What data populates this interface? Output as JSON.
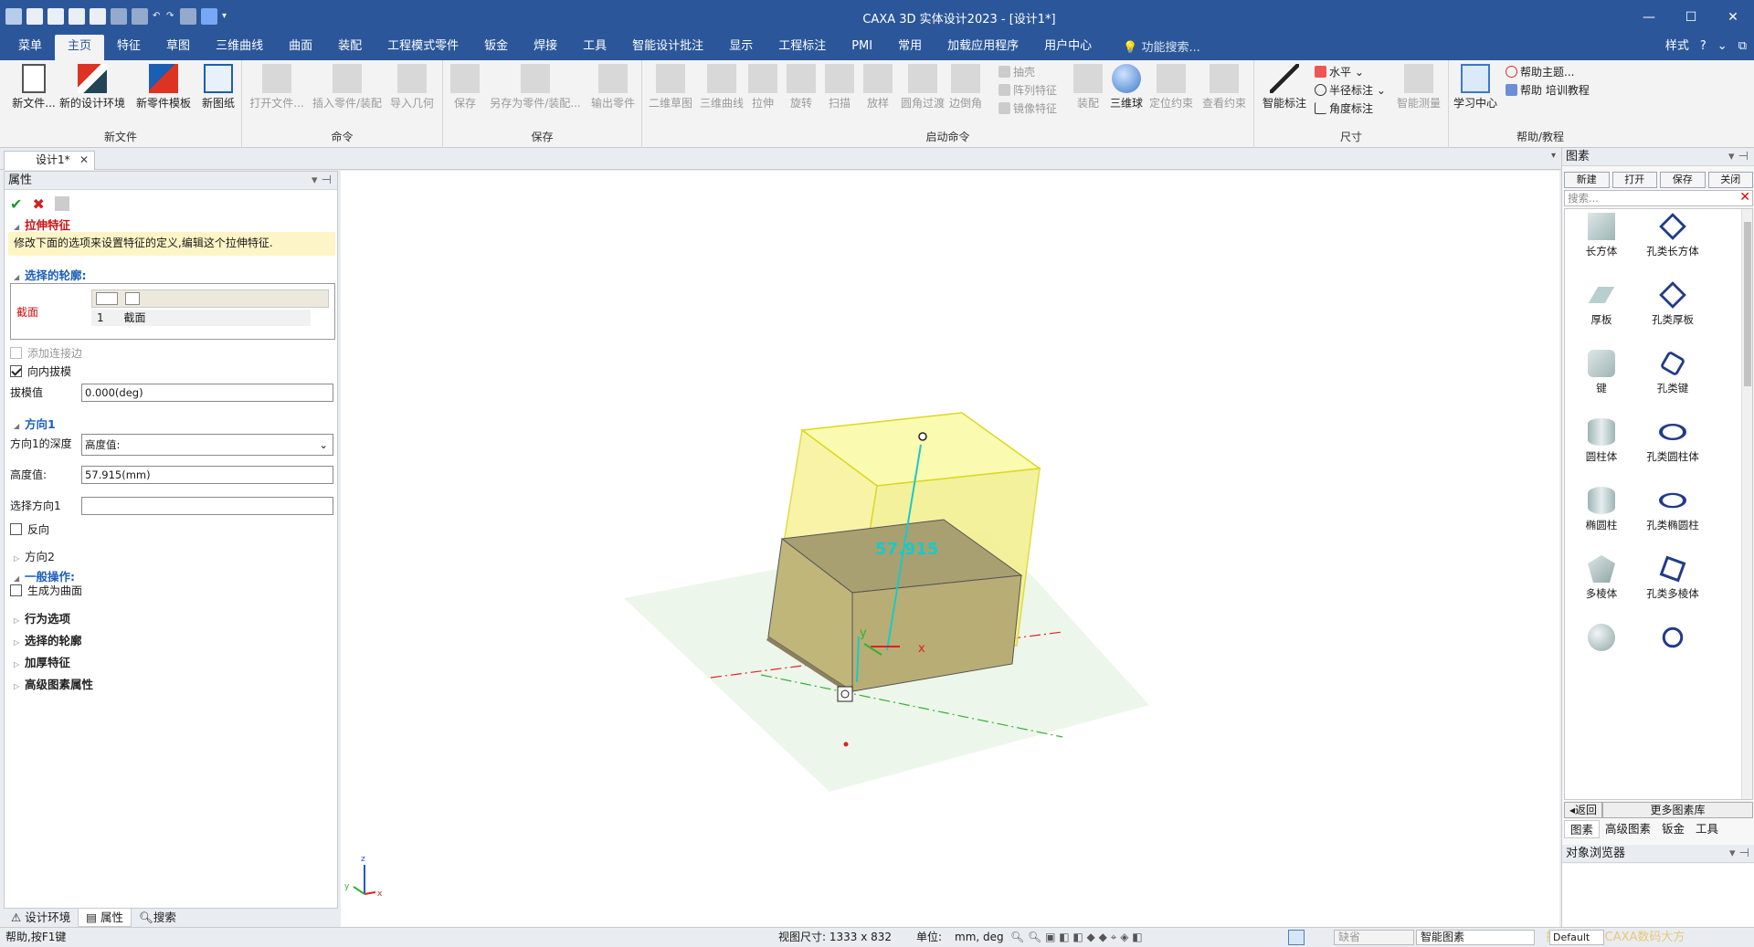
{
  "window": {
    "title": "CAXA 3D 实体设计2023 - [设计1*]",
    "controls": [
      "—",
      "☐",
      "✕"
    ]
  },
  "menubar": {
    "items": [
      "菜单",
      "主页",
      "特征",
      "草图",
      "三维曲线",
      "曲面",
      "装配",
      "工程模式零件",
      "钣金",
      "焊接",
      "工具",
      "智能设计批注",
      "显示",
      "工程标注",
      "PMI",
      "常用",
      "加载应用程序",
      "用户中心"
    ],
    "active": "主页",
    "search_placeholder": "功能搜索...",
    "style_label": "样式"
  },
  "ribbon": {
    "groups": {
      "new_file": "新文件",
      "command": "命令",
      "save": "保存",
      "launch": "启动命令",
      "dimension": "尺寸",
      "help": "帮助/教程"
    },
    "buttons": {
      "new_file": "新文件...",
      "new_design_env": "新的设计环境",
      "new_part_template": "新零件模板",
      "new_drawing": "新图纸",
      "open_file": "打开文件...",
      "insert_part": "插入零件/装配",
      "import_geometry": "导入几何",
      "save": "保存",
      "save_as_part": "另存为零件/装配...",
      "export_part": "输出零件",
      "sketch_2d": "二维草图",
      "curve_3d": "三维曲线",
      "extrude": "拉伸",
      "revolve": "旋转",
      "sweep": "扫描",
      "loft": "放样",
      "fillet_transition": "圆角过渡",
      "chamfer": "边倒角",
      "shell": "抽壳",
      "pattern": "阵列特征",
      "mirror": "镜像特征",
      "assembly": "装配",
      "triball": "三维球",
      "position_constraint": "定位约束",
      "view_constraint": "查看约束",
      "smart_dimension": "智能标注",
      "horizontal": "水平",
      "radius_dim": "半径标注",
      "angle_dim": "角度标注",
      "smart_measure": "智能测量",
      "learning_center": "学习中心",
      "help_topics": "帮助主题...",
      "help_training": "帮助 培训教程"
    }
  },
  "doc_tab": {
    "label": "设计1*"
  },
  "properties": {
    "header": "属性",
    "feature_title": "拉伸特征",
    "hint": "修改下面的选项来设置特征的定义,编辑这个拉伸特征.",
    "profile_section": "选择的轮廓:",
    "profile_label": "截面",
    "profile_row_index": "1",
    "profile_row_value": "截面",
    "add_tangent_edges": "添加连接边",
    "draft_inward": "向内拔模",
    "draft_value_label": "拔模值",
    "draft_value": "0.000(deg)",
    "direction1_section": "方向1",
    "depth_label": "方向1的深度",
    "depth_option": "高度值:",
    "height_label": "高度值:",
    "height_value": "57.915(mm)",
    "select_dir_label": "选择方向1",
    "select_dir_value": "",
    "reverse_label": "反向",
    "direction2_section": "方向2",
    "general_section": "一般操作:",
    "generate_surface": "生成为曲面",
    "collapsed_sections": [
      "行为选项",
      "选择的轮廓",
      "加厚特征",
      "高级图素属性"
    ]
  },
  "left_bottom_tabs": [
    "设计环境",
    "属性",
    "搜索"
  ],
  "viewport": {
    "dimension_label": "57.915",
    "axis_x": "x",
    "axis_y": "y",
    "axis_z": "z"
  },
  "library": {
    "header": "图素",
    "toolbar": [
      "新建",
      "打开",
      "保存",
      "关闭"
    ],
    "search_placeholder": "搜索...",
    "items": [
      "长方体",
      "孔类长方体",
      "厚板",
      "孔类厚板",
      "键",
      "孔类键",
      "圆柱体",
      "孔类圆柱体",
      "椭圆柱",
      "孔类椭圆柱",
      "多棱体",
      "孔类多棱体",
      "",
      ""
    ],
    "back_label": "返回",
    "more_label": "更多图素库",
    "tabs": [
      "图素",
      "高级图素",
      "钣金",
      "工具"
    ],
    "object_browser": "对象浏览器"
  },
  "statusbar": {
    "help": "帮助,按F1键",
    "view_size": "视图尺寸: 1333 x 832",
    "units": "单位:",
    "units_value": "mm, deg",
    "default_combo": "缺省",
    "smart_element": "智能图素",
    "watermark": "技术社区 | CAXA数码大方",
    "default_label": "Default"
  }
}
